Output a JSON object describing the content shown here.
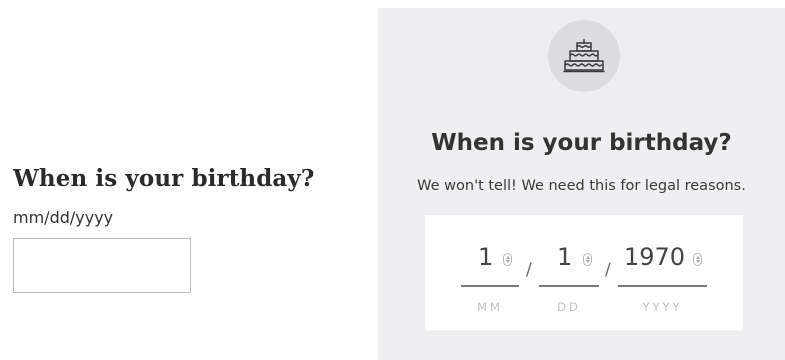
{
  "left_form": {
    "title": "When is your birthday?",
    "hint": "mm/dd/yyyy",
    "input_value": ""
  },
  "card": {
    "icon": "birthday-cake-icon",
    "title": "When is your birthday?",
    "subtitle": "We won't tell! We need this for legal reasons.",
    "separator": "/",
    "fields": [
      {
        "value": "1",
        "label": "MM"
      },
      {
        "value": "1",
        "label": "DD"
      },
      {
        "value": "1970",
        "label": "YYYY"
      }
    ]
  },
  "colors": {
    "card_background": "#efeff1",
    "icon_circle": "#dcdde1",
    "text": "#333333",
    "underline": "#7a7a7a",
    "field_label": "#c2c2c2"
  }
}
